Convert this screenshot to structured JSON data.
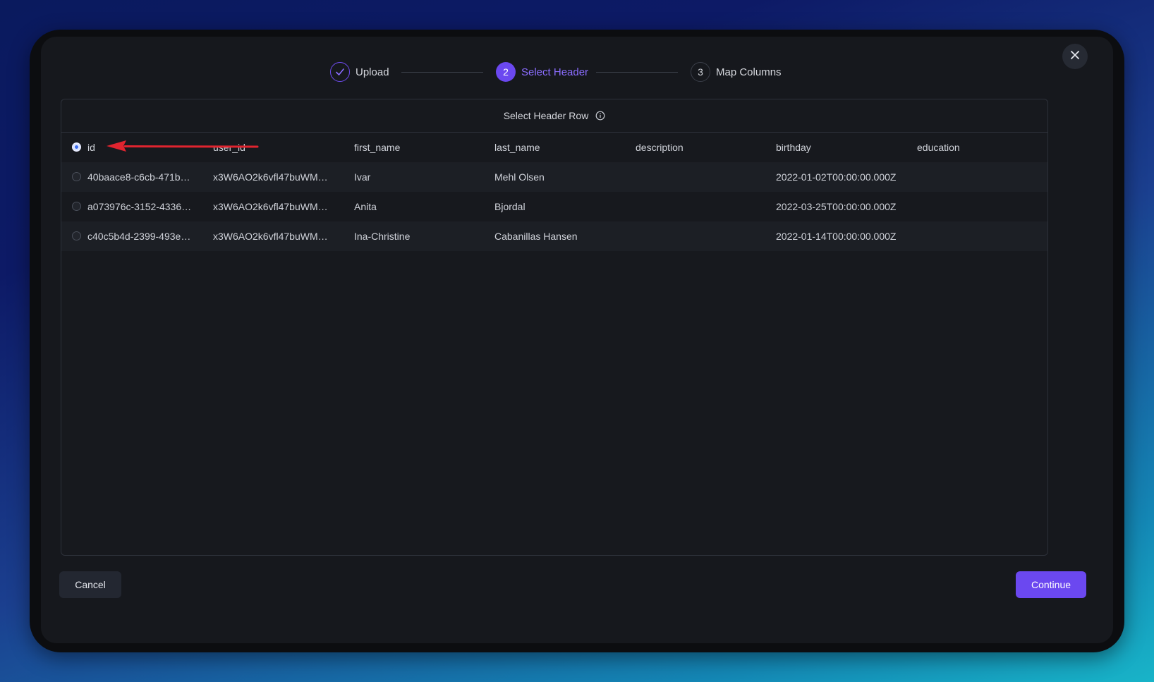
{
  "stepper": {
    "steps": [
      {
        "number": "",
        "label": "Upload",
        "state": "done"
      },
      {
        "number": "2",
        "label": "Select Header",
        "state": "active"
      },
      {
        "number": "3",
        "label": "Map Columns",
        "state": "pending"
      }
    ]
  },
  "panel": {
    "title": "Select Header Row"
  },
  "table": {
    "header": [
      "id",
      "user_id",
      "first_name",
      "last_name",
      "description",
      "birthday",
      "education"
    ],
    "rows": [
      [
        "40baace8-c6cb-471b-…",
        "x3W6AO2k6vfl47buWM6…",
        "Ivar",
        "Mehl Olsen",
        "",
        "2022-01-02T00:00:00.000Z",
        ""
      ],
      [
        "a073976c-3152-4336-…",
        "x3W6AO2k6vfl47buWM6…",
        "Anita",
        "Bjordal",
        "",
        "2022-03-25T00:00:00.000Z",
        ""
      ],
      [
        "c40c5b4d-2399-493e-…",
        "x3W6AO2k6vfl47buWM6…",
        "Ina-Christine",
        "Cabanillas Hansen",
        "",
        "2022-01-14T00:00:00.000Z",
        ""
      ]
    ]
  },
  "footer": {
    "cancel_label": "Cancel",
    "continue_label": "Continue"
  },
  "colors": {
    "accent": "#6b48f0",
    "annotation_arrow": "#e0242f"
  }
}
